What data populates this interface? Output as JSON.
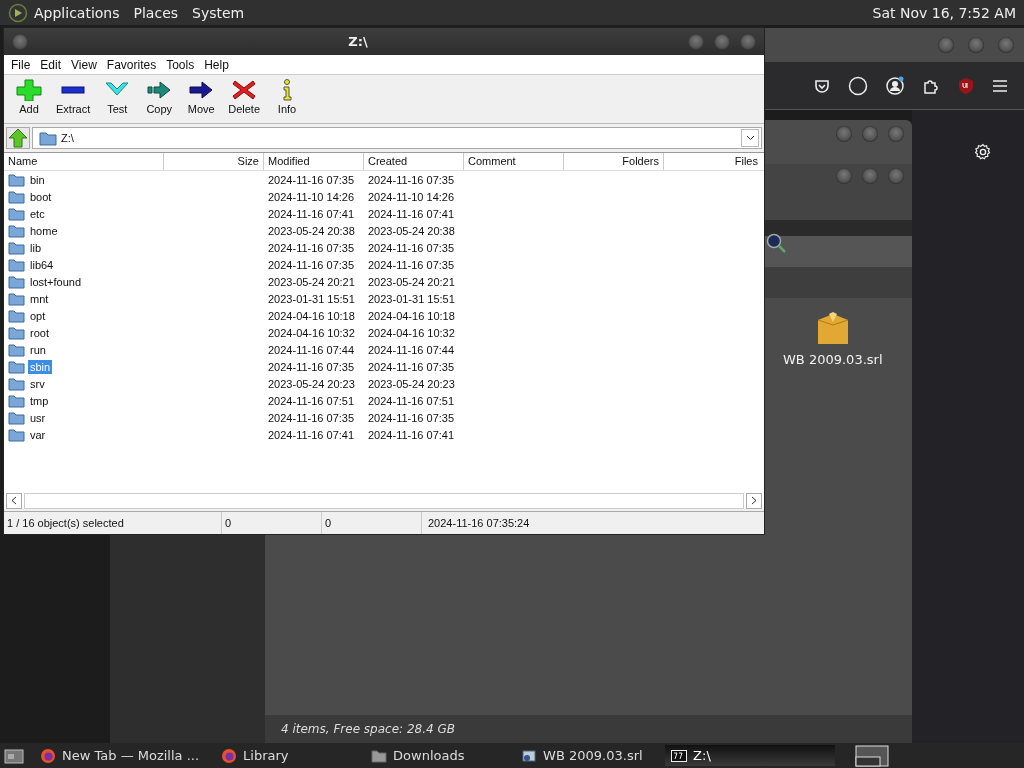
{
  "top_panel": {
    "menus": [
      "Applications",
      "Places",
      "System"
    ],
    "clock": "Sat Nov 16,  7:52 AM"
  },
  "desktop_file": {
    "label": "WB 2009.03.srl"
  },
  "file_manager": {
    "status": "4 items, Free space: 28.4 GB"
  },
  "window": {
    "title": "Z:\\",
    "menu": [
      "File",
      "Edit",
      "View",
      "Favorites",
      "Tools",
      "Help"
    ],
    "toolbar": [
      {
        "label": "Add",
        "kind": "add"
      },
      {
        "label": "Extract",
        "kind": "extract"
      },
      {
        "label": "Test",
        "kind": "test"
      },
      {
        "label": "Copy",
        "kind": "copy"
      },
      {
        "label": "Move",
        "kind": "move"
      },
      {
        "label": "Delete",
        "kind": "delete"
      },
      {
        "label": "Info",
        "kind": "info"
      }
    ],
    "path": "Z:\\",
    "columns": [
      "Name",
      "Size",
      "Modified",
      "Created",
      "Comment",
      "Folders",
      "Files"
    ],
    "rows": [
      {
        "name": "bin",
        "modified": "2024-11-16 07:35",
        "created": "2024-11-16 07:35",
        "selected": false
      },
      {
        "name": "boot",
        "modified": "2024-11-10 14:26",
        "created": "2024-11-10 14:26",
        "selected": false
      },
      {
        "name": "etc",
        "modified": "2024-11-16 07:41",
        "created": "2024-11-16 07:41",
        "selected": false
      },
      {
        "name": "home",
        "modified": "2023-05-24 20:38",
        "created": "2023-05-24 20:38",
        "selected": false
      },
      {
        "name": "lib",
        "modified": "2024-11-16 07:35",
        "created": "2024-11-16 07:35",
        "selected": false
      },
      {
        "name": "lib64",
        "modified": "2024-11-16 07:35",
        "created": "2024-11-16 07:35",
        "selected": false
      },
      {
        "name": "lost+found",
        "modified": "2023-05-24 20:21",
        "created": "2023-05-24 20:21",
        "selected": false
      },
      {
        "name": "mnt",
        "modified": "2023-01-31 15:51",
        "created": "2023-01-31 15:51",
        "selected": false
      },
      {
        "name": "opt",
        "modified": "2024-04-16 10:18",
        "created": "2024-04-16 10:18",
        "selected": false
      },
      {
        "name": "root",
        "modified": "2024-04-16 10:32",
        "created": "2024-04-16 10:32",
        "selected": false
      },
      {
        "name": "run",
        "modified": "2024-11-16 07:44",
        "created": "2024-11-16 07:44",
        "selected": false
      },
      {
        "name": "sbin",
        "modified": "2024-11-16 07:35",
        "created": "2024-11-16 07:35",
        "selected": true
      },
      {
        "name": "srv",
        "modified": "2023-05-24 20:23",
        "created": "2023-05-24 20:23",
        "selected": false
      },
      {
        "name": "tmp",
        "modified": "2024-11-16 07:51",
        "created": "2024-11-16 07:51",
        "selected": false
      },
      {
        "name": "usr",
        "modified": "2024-11-16 07:35",
        "created": "2024-11-16 07:35",
        "selected": false
      },
      {
        "name": "var",
        "modified": "2024-11-16 07:41",
        "created": "2024-11-16 07:41",
        "selected": false
      }
    ],
    "status": [
      "1 / 16 object(s) selected",
      "0",
      "0",
      "2024-11-16 07:35:24"
    ]
  },
  "taskbar": [
    {
      "label": "New Tab — Mozilla ...",
      "kind": "firefox",
      "selected": false
    },
    {
      "label": "Library",
      "kind": "firefox",
      "selected": false
    },
    {
      "label": "Downloads",
      "kind": "folder",
      "selected": false
    },
    {
      "label": "WB 2009.03.srl",
      "kind": "app",
      "selected": false
    },
    {
      "label": "Z:\\",
      "kind": "zip",
      "selected": true
    }
  ]
}
